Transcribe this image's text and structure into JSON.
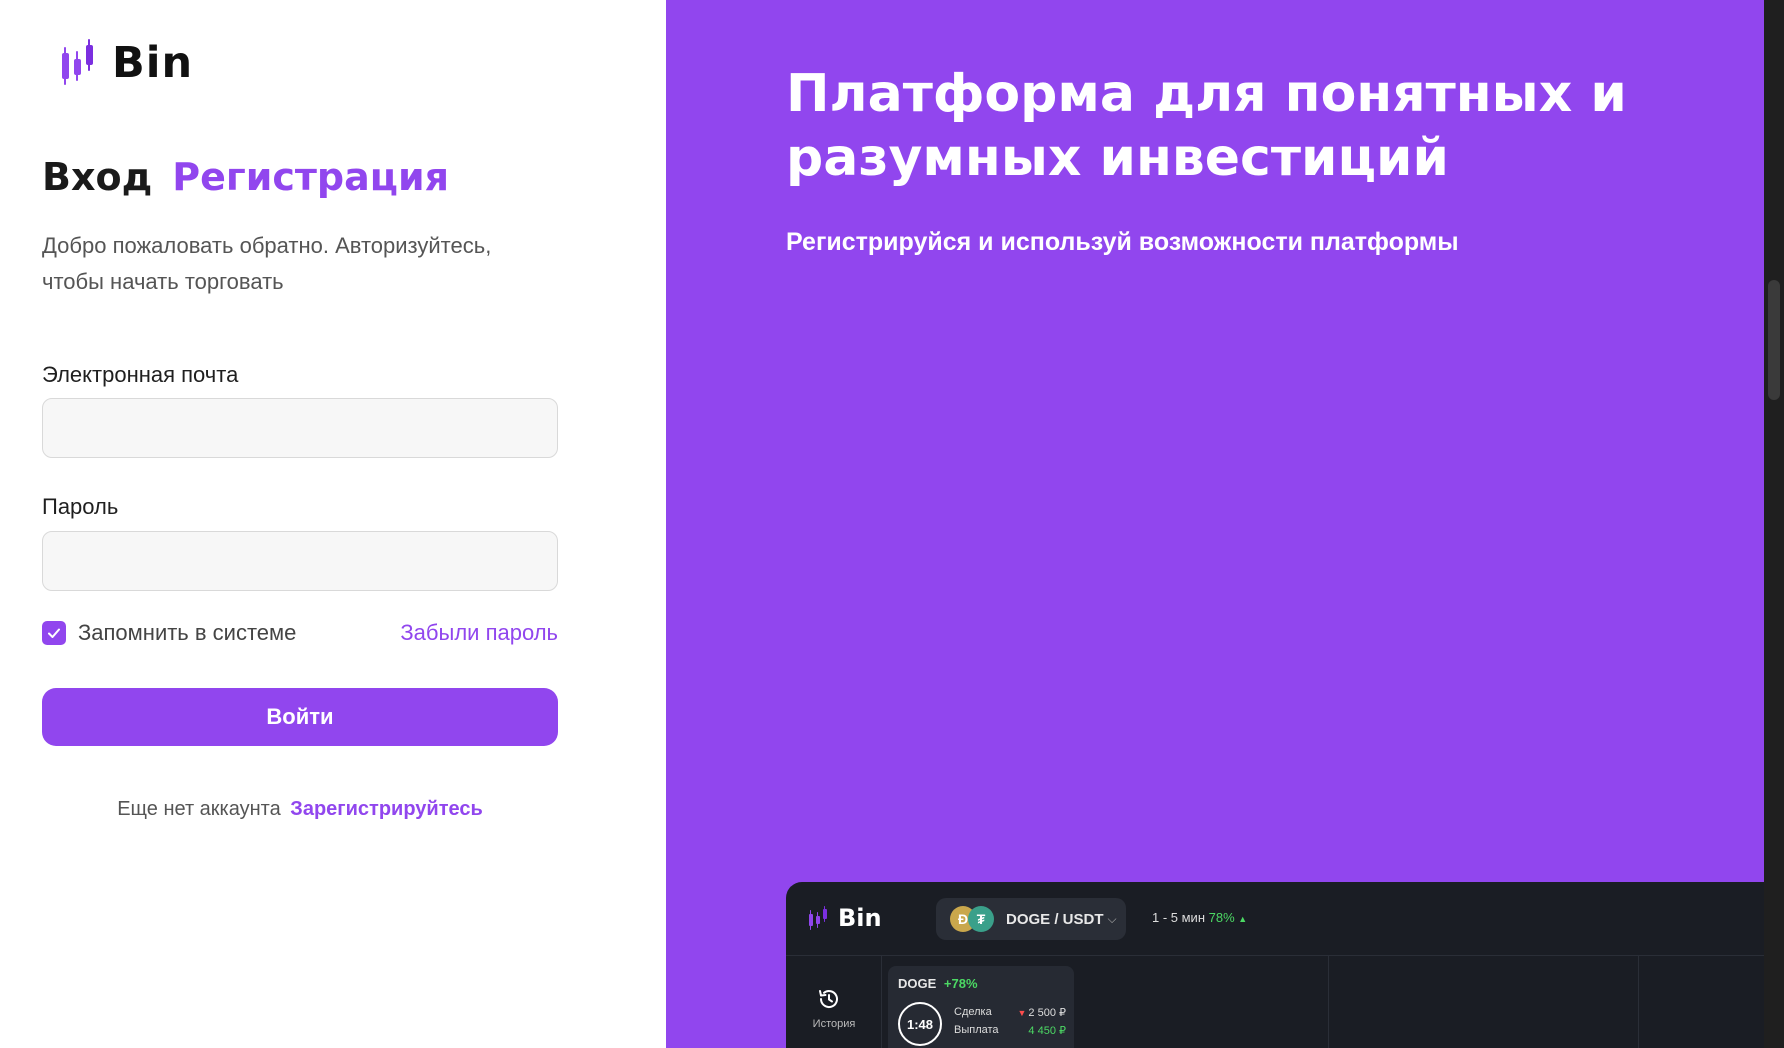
{
  "brand": {
    "name": "Bin",
    "accent": "#9146ee"
  },
  "auth": {
    "tab_login": "Вход",
    "tab_register": "Регистрация",
    "welcome": "Добро пожаловать обратно. Авторизуйтесь, чтобы начать торговать",
    "email_label": "Электронная почта",
    "email_value": "",
    "password_label": "Пароль",
    "password_value": "",
    "remember_label": "Запомнить в системе",
    "remember_checked": true,
    "forgot_label": "Забыли пароль",
    "submit_label": "Войти",
    "no_account_text": "Еще нет аккаунта",
    "signup_link": "Зарегистрируйтесь"
  },
  "promo": {
    "title": "Платформа для понятных и разумных инвестиций",
    "subtitle": "Регистрируйся и используй возможности платформы"
  },
  "preview": {
    "logo": "Bin",
    "pair": "DOGE / USDT",
    "range": "1 - 5 мин",
    "range_percent": "78%",
    "history_label": "История",
    "card_asset": "DOGE",
    "card_change": "+78%",
    "timer": "1:48",
    "deal_label": "Сделка",
    "deal_value": "2 500 ₽",
    "payout_label": "Выплата",
    "payout_value": "4 450 ₽"
  }
}
